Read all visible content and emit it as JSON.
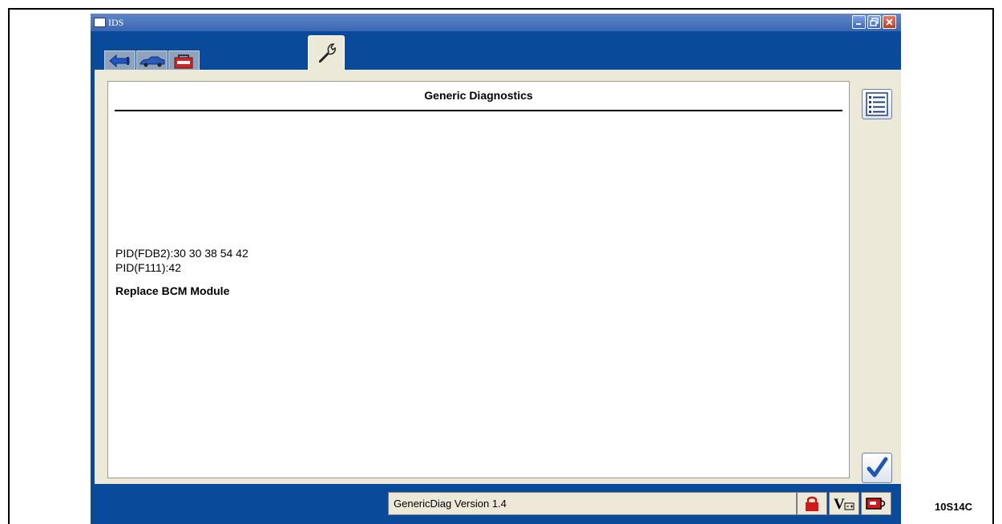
{
  "window": {
    "title": "IDS",
    "minimize_icon": "minimize-icon",
    "restore_icon": "restore-icon",
    "close_icon": "close-icon"
  },
  "tabs": [
    {
      "name": "connection",
      "icon": "plug-connector-icon"
    },
    {
      "name": "vehicle",
      "icon": "car-icon"
    },
    {
      "name": "toolbox",
      "icon": "toolbox-icon"
    },
    {
      "name": "generic-diagnostics",
      "icon": "wrench-icon",
      "active": true
    }
  ],
  "panel": {
    "title": "Generic Diagnostics",
    "lines": [
      "PID(FDB2):30 30 38 54 42",
      "PID(F111):42",
      "Replace BCM Module"
    ]
  },
  "side_buttons": {
    "list": "list-icon",
    "confirm": "checkmark-icon"
  },
  "status": {
    "version_text": "GenericDiag Version 1.4",
    "icons": [
      "lock-icon",
      "voltage-battery-icon",
      "vcm-connection-icon"
    ]
  },
  "caption": "10S14C",
  "colors": {
    "window_blue": "#0a4a9a",
    "content_bg": "#ece9d8",
    "titlebar": "#3b66b2"
  }
}
